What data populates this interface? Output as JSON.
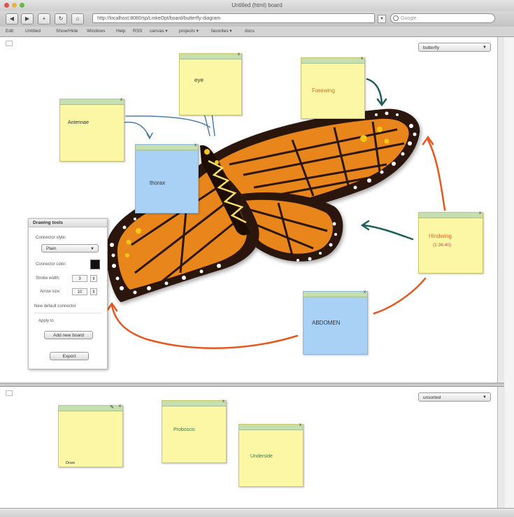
{
  "browser": {
    "title": "Untitled (html) board",
    "url": "http://localhost:8080/sp/LinkeOpt/board/butterfly-diagram",
    "search_placeholder": "Google",
    "nav": {
      "back": "◀",
      "forward": "▶",
      "add": "+",
      "reload": "↻"
    },
    "bookmarks": [
      "Edit",
      "Untitled",
      "Show/Hide",
      "Windows",
      "Help",
      "RSS",
      "canvas ▾",
      "projects ▾",
      "favorites ▾",
      "docs"
    ]
  },
  "top_panel": {
    "dropdown": "butterfly",
    "notes": {
      "antennae": "Antennae",
      "eye": "eye",
      "forewing": "Forewing",
      "thorax": "thorax",
      "hindwing": "Hindwing",
      "hindwing_sub": "(1:36:40)",
      "abdomen": "ABDOMEN"
    }
  },
  "drawing_tools": {
    "title": "Drawing tools",
    "connector_label": "Connector style:",
    "connector_value": "Plain",
    "color_label": "Connector color:",
    "width_label": "Stroke width:",
    "width_value": "3",
    "arrow_label": "Arrow size:",
    "arrow_value": "10",
    "new_label": "New default connector",
    "apply_label": "Apply to",
    "btn_add": "Add new board",
    "btn_export": "Export",
    "color": "#111111"
  },
  "bottom_panel": {
    "dropdown": "unsorted",
    "notes": {
      "note1_footer": "Draw",
      "note2": "Proboscis",
      "note3": "Underside"
    }
  },
  "colors": {
    "note_yellow": "#fbf7a5",
    "note_blue": "#a9d0f5",
    "note_bar": "#c5e0ae",
    "arrow_orange": "#e8561e",
    "arrow_teal": "#1f5f5a",
    "arrow_blue": "#4d7ea8"
  }
}
